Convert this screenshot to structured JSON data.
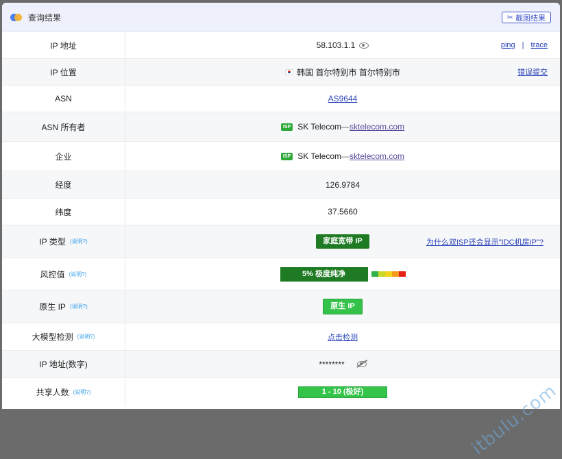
{
  "header": {
    "title": "查询结果",
    "screenshot_label": "截图结果"
  },
  "rows": {
    "ip": {
      "label": "IP 地址",
      "value": "58.103.1.1",
      "ping": "ping",
      "sep": "|",
      "trace": "trace"
    },
    "location": {
      "label": "IP 位置",
      "value": "韩国 首尔特别市 首尔特别市",
      "report": "错误提交"
    },
    "asn": {
      "label": "ASN",
      "value": "AS9644"
    },
    "asn_owner": {
      "label": "ASN 所有者",
      "tag": "ISP",
      "name": "SK Telecom",
      "dash": "— ",
      "domain": "sktelecom.com"
    },
    "company": {
      "label": "企业",
      "tag": "ISP",
      "name": "SK Telecom",
      "dash": "— ",
      "domain": "sktelecom.com"
    },
    "longitude": {
      "label": "经度",
      "value": "126.9784"
    },
    "latitude": {
      "label": "纬度",
      "value": "37.5660"
    },
    "ip_type": {
      "label": "IP 类型",
      "help": "(说明?)",
      "value": "家庭宽带 IP",
      "link": "为什么双ISP还会显示\"IDC机房IP\"?"
    },
    "risk": {
      "label": "风控值",
      "help": "(说明?)",
      "value": "5%  极度纯净",
      "scale_colors": [
        "#2fb24a",
        "#c8d92a",
        "#f2d41a",
        "#f29a1a",
        "#e8201a"
      ]
    },
    "native": {
      "label": "原生 IP",
      "help": "(说明?)",
      "value": "原生 IP"
    },
    "llm": {
      "label": "大模型检测",
      "help": "(说明?)",
      "value": "点击检测"
    },
    "ip_numeric": {
      "label": "IP 地址(数字)",
      "value": "********"
    },
    "shared": {
      "label": "共享人数",
      "help": "(说明?)",
      "value": "1 - 10 (极好)"
    }
  },
  "watermark": "itbulu.com"
}
